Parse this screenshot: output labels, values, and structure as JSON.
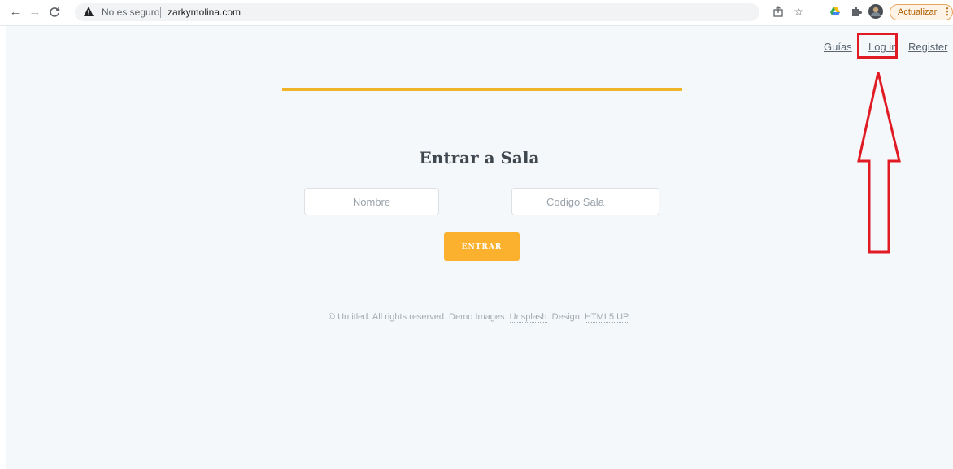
{
  "browser": {
    "security_label": "No es seguro",
    "url": "zarkymolina.com",
    "update_label": "Actualizar",
    "menu_glyph": "⋮",
    "icons": [
      "back-arrow-icon",
      "forward-arrow-icon",
      "reload-icon",
      "warning-icon",
      "share-icon",
      "star-icon",
      "drive-icon",
      "extensions-icon",
      "profile-avatar-icon",
      "menu-icon"
    ]
  },
  "nav": {
    "links": [
      "Guías",
      "Log in",
      "Register"
    ]
  },
  "main": {
    "title": "Entrar a Sala",
    "nombre_placeholder": "Nombre",
    "codigo_placeholder": "Codigo Sala",
    "button_label": "ENTRAR"
  },
  "footer": {
    "text": "© Untitled. All rights reserved. Demo Images:",
    "unsplash": "Unsplash",
    "design_label": ". Design:",
    "html5up": "HTML5 UP",
    "end": "."
  },
  "colors": {
    "accent": "#f0b429",
    "button": "#fbb12d",
    "annotation": "#e01b24",
    "page_bg": "#f5f8fb"
  }
}
